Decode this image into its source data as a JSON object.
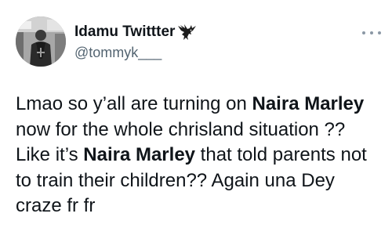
{
  "author": {
    "display_name": "Idamu Twittter",
    "handle": "@tommyk___",
    "badge_icon": "eagle-icon",
    "avatar_icon": "profile-photo"
  },
  "menu": {
    "icon": "more-icon"
  },
  "tweet": {
    "segments": [
      {
        "text": "Lmao so y’all are turning on ",
        "bold": false
      },
      {
        "text": "Naira Marley",
        "bold": true
      },
      {
        "text": " now for the whole chrisland situation ?? Like it’s ",
        "bold": false
      },
      {
        "text": "Naira Marley",
        "bold": true
      },
      {
        "text": " that told parents not to train their children?? Again una Dey craze fr fr",
        "bold": false
      }
    ]
  },
  "colors": {
    "text": "#0f1419",
    "secondary": "#536471",
    "background": "#ffffff"
  }
}
